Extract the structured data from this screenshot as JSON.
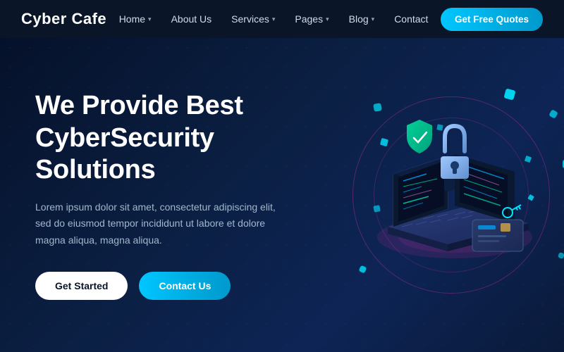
{
  "brand": {
    "logo": "Cyber Cafe"
  },
  "navbar": {
    "links": [
      {
        "label": "Home",
        "hasDropdown": true
      },
      {
        "label": "About Us",
        "hasDropdown": false
      },
      {
        "label": "Services",
        "hasDropdown": true
      },
      {
        "label": "Pages",
        "hasDropdown": true
      },
      {
        "label": "Blog",
        "hasDropdown": true
      },
      {
        "label": "Contact",
        "hasDropdown": false
      }
    ],
    "cta": "Get Free Quotes"
  },
  "hero": {
    "title_line1": "We Provide Best",
    "title_line2": "CyberSecurity Solutions",
    "subtitle": "Lorem ipsum dolor sit amet, consectetur adipiscing elit, sed do eiusmod tempor incididunt ut labore et dolore magna aliqua, magna aliqua.",
    "btn_primary": "Get Started",
    "btn_secondary": "Contact Us"
  }
}
